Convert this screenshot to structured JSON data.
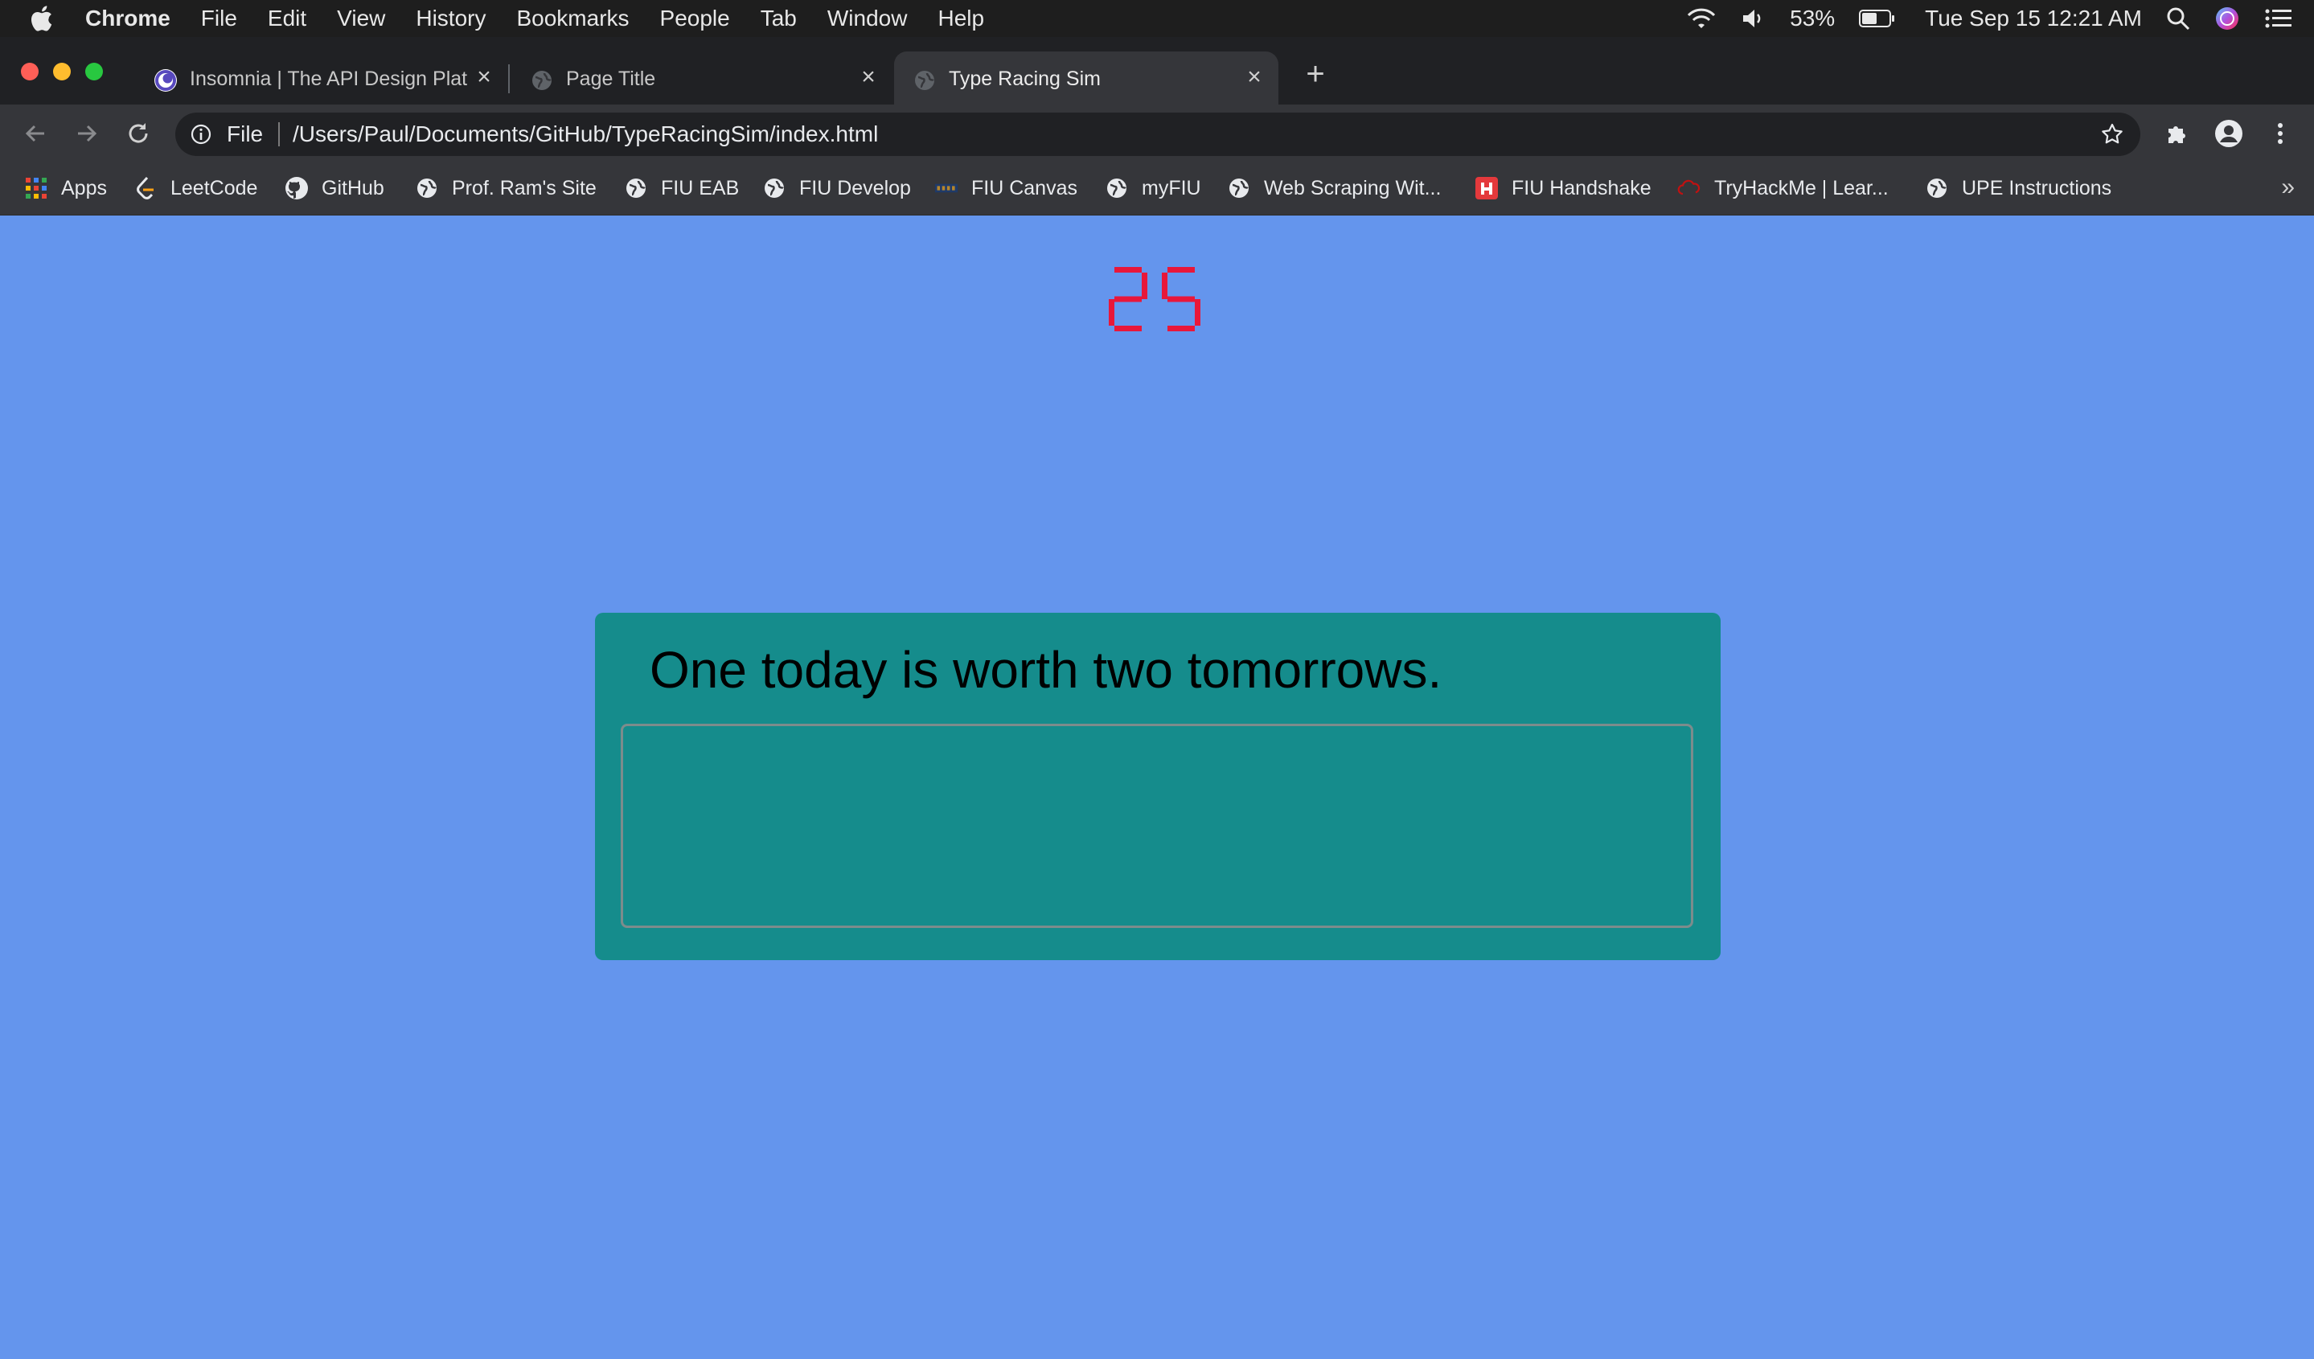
{
  "menubar": {
    "app_name": "Chrome",
    "items": [
      "File",
      "Edit",
      "View",
      "History",
      "Bookmarks",
      "People",
      "Tab",
      "Window",
      "Help"
    ],
    "battery": "53%",
    "clock": "Tue Sep 15  12:21 AM"
  },
  "tabs": [
    {
      "title": "Insomnia | The API Design Plat",
      "favicon": "insomnia-icon",
      "active": false
    },
    {
      "title": "Page Title",
      "favicon": "globe-icon",
      "active": false
    },
    {
      "title": "Type Racing Sim",
      "favicon": "globe-icon",
      "active": true
    }
  ],
  "toolbar": {
    "scheme": "File",
    "url": "/Users/Paul/Documents/GitHub/TypeRacingSim/index.html"
  },
  "bookmarks": [
    {
      "label": "Apps",
      "icon": "apps-grid-icon"
    },
    {
      "label": "LeetCode",
      "icon": "leetcode-icon"
    },
    {
      "label": "GitHub",
      "icon": "github-icon"
    },
    {
      "label": "Prof. Ram's Site",
      "icon": "globe-icon"
    },
    {
      "label": "FIU EAB",
      "icon": "globe-icon"
    },
    {
      "label": "FIU Develop",
      "icon": "globe-icon"
    },
    {
      "label": "FIU Canvas",
      "icon": "fiu-icon"
    },
    {
      "label": "myFIU",
      "icon": "globe-icon"
    },
    {
      "label": "Web Scraping Wit...",
      "icon": "globe-icon"
    },
    {
      "label": "FIU Handshake",
      "icon": "handshake-icon"
    },
    {
      "label": "TryHackMe | Lear...",
      "icon": "tryhackme-icon"
    },
    {
      "label": "UPE Instructions",
      "icon": "globe-icon"
    }
  ],
  "page": {
    "timer": "25",
    "timer_color": "#e8173a",
    "quote": "One today is worth two tomorrows.",
    "input_value": "",
    "background_color": "#6495ed",
    "card_color": "#158c8c"
  }
}
